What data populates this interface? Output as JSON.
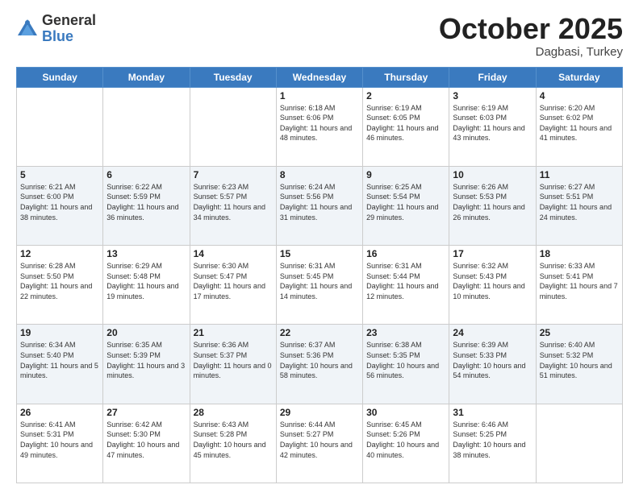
{
  "header": {
    "logo": {
      "general": "General",
      "blue": "Blue"
    },
    "title": "October 2025",
    "location": "Dagbasi, Turkey"
  },
  "days_of_week": [
    "Sunday",
    "Monday",
    "Tuesday",
    "Wednesday",
    "Thursday",
    "Friday",
    "Saturday"
  ],
  "weeks": [
    [
      {
        "day": "",
        "info": ""
      },
      {
        "day": "",
        "info": ""
      },
      {
        "day": "",
        "info": ""
      },
      {
        "day": "1",
        "info": "Sunrise: 6:18 AM\nSunset: 6:06 PM\nDaylight: 11 hours\nand 48 minutes."
      },
      {
        "day": "2",
        "info": "Sunrise: 6:19 AM\nSunset: 6:05 PM\nDaylight: 11 hours\nand 46 minutes."
      },
      {
        "day": "3",
        "info": "Sunrise: 6:19 AM\nSunset: 6:03 PM\nDaylight: 11 hours\nand 43 minutes."
      },
      {
        "day": "4",
        "info": "Sunrise: 6:20 AM\nSunset: 6:02 PM\nDaylight: 11 hours\nand 41 minutes."
      }
    ],
    [
      {
        "day": "5",
        "info": "Sunrise: 6:21 AM\nSunset: 6:00 PM\nDaylight: 11 hours\nand 38 minutes."
      },
      {
        "day": "6",
        "info": "Sunrise: 6:22 AM\nSunset: 5:59 PM\nDaylight: 11 hours\nand 36 minutes."
      },
      {
        "day": "7",
        "info": "Sunrise: 6:23 AM\nSunset: 5:57 PM\nDaylight: 11 hours\nand 34 minutes."
      },
      {
        "day": "8",
        "info": "Sunrise: 6:24 AM\nSunset: 5:56 PM\nDaylight: 11 hours\nand 31 minutes."
      },
      {
        "day": "9",
        "info": "Sunrise: 6:25 AM\nSunset: 5:54 PM\nDaylight: 11 hours\nand 29 minutes."
      },
      {
        "day": "10",
        "info": "Sunrise: 6:26 AM\nSunset: 5:53 PM\nDaylight: 11 hours\nand 26 minutes."
      },
      {
        "day": "11",
        "info": "Sunrise: 6:27 AM\nSunset: 5:51 PM\nDaylight: 11 hours\nand 24 minutes."
      }
    ],
    [
      {
        "day": "12",
        "info": "Sunrise: 6:28 AM\nSunset: 5:50 PM\nDaylight: 11 hours\nand 22 minutes."
      },
      {
        "day": "13",
        "info": "Sunrise: 6:29 AM\nSunset: 5:48 PM\nDaylight: 11 hours\nand 19 minutes."
      },
      {
        "day": "14",
        "info": "Sunrise: 6:30 AM\nSunset: 5:47 PM\nDaylight: 11 hours\nand 17 minutes."
      },
      {
        "day": "15",
        "info": "Sunrise: 6:31 AM\nSunset: 5:45 PM\nDaylight: 11 hours\nand 14 minutes."
      },
      {
        "day": "16",
        "info": "Sunrise: 6:31 AM\nSunset: 5:44 PM\nDaylight: 11 hours\nand 12 minutes."
      },
      {
        "day": "17",
        "info": "Sunrise: 6:32 AM\nSunset: 5:43 PM\nDaylight: 11 hours\nand 10 minutes."
      },
      {
        "day": "18",
        "info": "Sunrise: 6:33 AM\nSunset: 5:41 PM\nDaylight: 11 hours\nand 7 minutes."
      }
    ],
    [
      {
        "day": "19",
        "info": "Sunrise: 6:34 AM\nSunset: 5:40 PM\nDaylight: 11 hours\nand 5 minutes."
      },
      {
        "day": "20",
        "info": "Sunrise: 6:35 AM\nSunset: 5:39 PM\nDaylight: 11 hours\nand 3 minutes."
      },
      {
        "day": "21",
        "info": "Sunrise: 6:36 AM\nSunset: 5:37 PM\nDaylight: 11 hours\nand 0 minutes."
      },
      {
        "day": "22",
        "info": "Sunrise: 6:37 AM\nSunset: 5:36 PM\nDaylight: 10 hours\nand 58 minutes."
      },
      {
        "day": "23",
        "info": "Sunrise: 6:38 AM\nSunset: 5:35 PM\nDaylight: 10 hours\nand 56 minutes."
      },
      {
        "day": "24",
        "info": "Sunrise: 6:39 AM\nSunset: 5:33 PM\nDaylight: 10 hours\nand 54 minutes."
      },
      {
        "day": "25",
        "info": "Sunrise: 6:40 AM\nSunset: 5:32 PM\nDaylight: 10 hours\nand 51 minutes."
      }
    ],
    [
      {
        "day": "26",
        "info": "Sunrise: 6:41 AM\nSunset: 5:31 PM\nDaylight: 10 hours\nand 49 minutes."
      },
      {
        "day": "27",
        "info": "Sunrise: 6:42 AM\nSunset: 5:30 PM\nDaylight: 10 hours\nand 47 minutes."
      },
      {
        "day": "28",
        "info": "Sunrise: 6:43 AM\nSunset: 5:28 PM\nDaylight: 10 hours\nand 45 minutes."
      },
      {
        "day": "29",
        "info": "Sunrise: 6:44 AM\nSunset: 5:27 PM\nDaylight: 10 hours\nand 42 minutes."
      },
      {
        "day": "30",
        "info": "Sunrise: 6:45 AM\nSunset: 5:26 PM\nDaylight: 10 hours\nand 40 minutes."
      },
      {
        "day": "31",
        "info": "Sunrise: 6:46 AM\nSunset: 5:25 PM\nDaylight: 10 hours\nand 38 minutes."
      },
      {
        "day": "",
        "info": ""
      }
    ]
  ]
}
